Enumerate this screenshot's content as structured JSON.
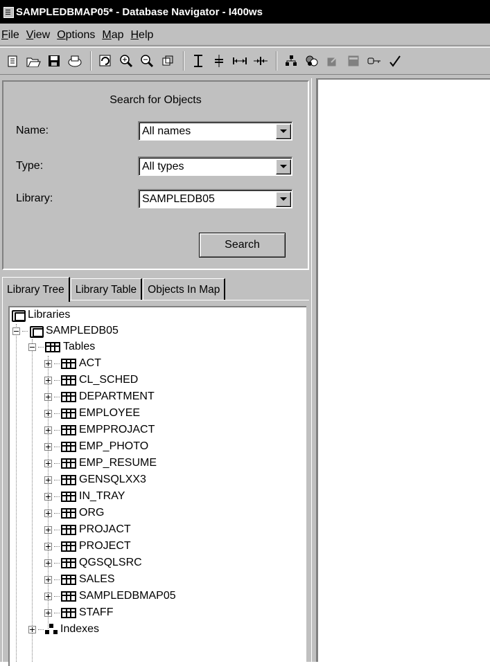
{
  "window": {
    "title": "SAMPLEDBMAP05* - Database Navigator - I400ws"
  },
  "menubar": {
    "items": [
      {
        "label": "File",
        "mnemonic": "F",
        "rest": "ile"
      },
      {
        "label": "View",
        "mnemonic": "V",
        "rest": "iew"
      },
      {
        "label": "Options",
        "mnemonic": "O",
        "rest": "ptions"
      },
      {
        "label": "Map",
        "mnemonic": "M",
        "rest": "ap"
      },
      {
        "label": "Help",
        "mnemonic": "H",
        "rest": "elp"
      }
    ]
  },
  "toolbar": {
    "buttons": [
      "new-icon",
      "open-icon",
      "save-icon",
      "print-icon",
      "refresh-icon",
      "zoom-in-icon",
      "zoom-out-icon",
      "fit-window-icon",
      "align-vertical-icon",
      "center-vertical-icon",
      "spread-horizontal-icon",
      "compress-horizontal-icon",
      "hierarchy-icon",
      "properties-icon",
      "edit-icon",
      "table-icon",
      "key-icon",
      "check-icon"
    ]
  },
  "search": {
    "title": "Search for Objects",
    "name_label": "Name:",
    "name_value": "All names",
    "type_label": "Type:",
    "type_value": "All types",
    "library_label": "Library:",
    "library_value": "SAMPLEDB05",
    "button_label": "Search"
  },
  "tabs": [
    {
      "label": "Library Tree",
      "active": true
    },
    {
      "label": "Library Table",
      "active": false
    },
    {
      "label": "Objects In Map",
      "active": false
    }
  ],
  "tree": {
    "root": "Libraries",
    "library": "SAMPLEDB05",
    "tables_folder": "Tables",
    "tables": [
      "ACT",
      "CL_SCHED",
      "DEPARTMENT",
      "EMPLOYEE",
      "EMPPROJACT",
      "EMP_PHOTO",
      "EMP_RESUME",
      "GENSQLXX3",
      "IN_TRAY",
      "ORG",
      "PROJACT",
      "PROJECT",
      "QGSQLSRC",
      "SALES",
      "SAMPLEDBMAP05",
      "STAFF"
    ],
    "indexes_folder": "Indexes"
  }
}
